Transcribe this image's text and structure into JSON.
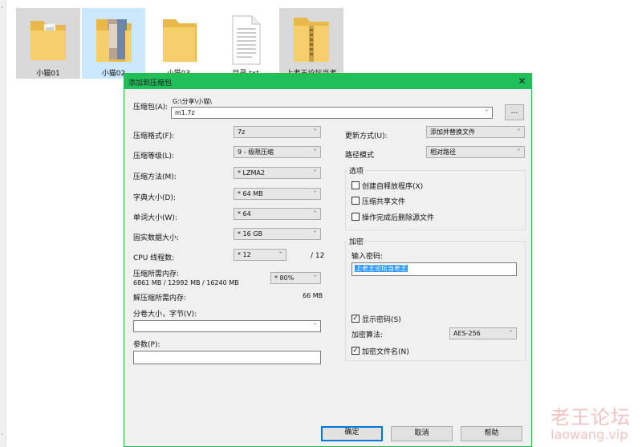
{
  "desktop": {
    "files": [
      {
        "name": "小猫01"
      },
      {
        "name": "小猫02"
      },
      {
        "name": "小猫03"
      },
      {
        "name": "目录.txt"
      },
      {
        "name": "上老王论坛当老"
      }
    ]
  },
  "dialog": {
    "title": "添加到压缩包",
    "close": "✕",
    "archive_label": "压缩包(A):",
    "archive_path": "G:\\分享\\小猫\\",
    "archive_name": "m1.7z",
    "browse": "...",
    "format_label": "压缩格式(F):",
    "format_value": "7z",
    "level_label": "压缩等级(L):",
    "level_value": "9 - 极限压缩",
    "method_label": "压缩方法(M):",
    "method_value": "* LZMA2",
    "dict_label": "字典大小(D):",
    "dict_value": "* 64 MB",
    "word_label": "单词大小(W):",
    "word_value": "* 64",
    "solid_label": "固实数据大小:",
    "solid_value": "* 16 GB",
    "cpu_label": "CPU 线程数:",
    "cpu_value": "* 12",
    "cpu_total": "/ 12",
    "mem_label": "压缩所需内存:",
    "mem_values": "6861 MB / 12992 MB / 16240 MB",
    "mem_percent": "* 80%",
    "decomp_label": "解压缩所需内存:",
    "decomp_value": "66 MB",
    "split_label": "分卷大小，字节(V):",
    "split_value": "",
    "params_label": "参数(P):",
    "params_value": "",
    "update_label": "更新方式(U):",
    "update_value": "添加并替换文件",
    "path_label": "路径模式",
    "path_value": "相对路径",
    "options": {
      "title": "选项",
      "items": [
        {
          "label": "创建自释放程序(X)",
          "checked": false
        },
        {
          "label": "压缩共享文件",
          "checked": false
        },
        {
          "label": "操作完成后删除源文件",
          "checked": false
        }
      ]
    },
    "encryption": {
      "title": "加密",
      "password_label": "输入密码:",
      "password_value": "上老王论坛当老王",
      "show_password": {
        "label": "显示密码(S)",
        "checked": true
      },
      "method_label": "加密算法:",
      "method_value": "AES-256",
      "encrypt_names": {
        "label": "加密文件名(N)",
        "checked": true
      }
    },
    "buttons": {
      "ok": "确定",
      "cancel": "取消",
      "help": "帮助"
    }
  },
  "watermark": {
    "cn": "老王论坛",
    "url": "laowang.vip"
  },
  "icons": {
    "dropdown": "chevron-down-icon",
    "close": "close-icon",
    "check": "check-icon"
  }
}
